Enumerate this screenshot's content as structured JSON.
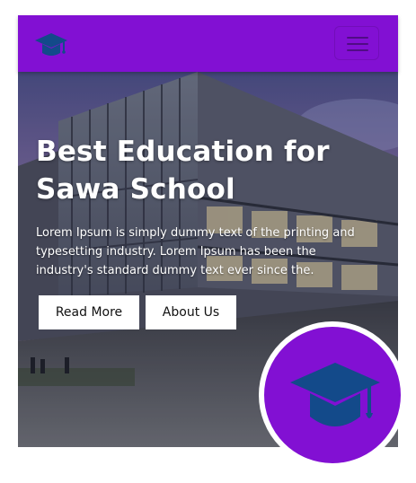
{
  "colors": {
    "brand": "#8210d3",
    "cap": "#134a8a",
    "white": "#ffffff"
  },
  "navbar": {
    "logo_icon": "graduation-cap-icon",
    "menu_icon": "hamburger-menu-icon"
  },
  "hero": {
    "title_line1": "Best Education for",
    "title_line2": "Sawa School",
    "text": "Lorem Ipsum is simply dummy text of the printing and typesetting industry. Lorem Ipsum has been the industry's standard dummy text ever since the.",
    "buttons": {
      "read_more": "Read More",
      "about_us": "About Us"
    }
  },
  "badge": {
    "icon": "graduation-cap-icon"
  }
}
